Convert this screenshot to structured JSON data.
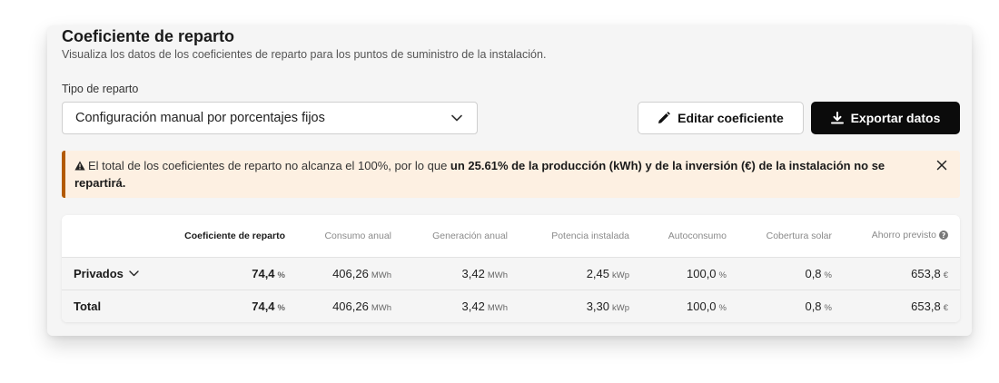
{
  "header": {
    "title": "Coeficiente de reparto",
    "subtitle": "Visualiza los datos de los coeficientes de reparto para los puntos de suministro de la instalación."
  },
  "distribution": {
    "label": "Tipo de reparto",
    "selected": "Configuración manual por porcentajes fijos"
  },
  "actions": {
    "edit_label": "Editar coeficiente",
    "export_label": "Exportar datos"
  },
  "alert": {
    "text_before": "El total de los coeficientes de reparto no alcanza el 100%, por lo que ",
    "text_bold": "un 25.61% de la producción (kWh) y de la inversión (€) de la instalación no se repartirá.",
    "color_border": "#b35a00",
    "color_bg": "#fdf0e2"
  },
  "table": {
    "columns": [
      "",
      "Coeficiente de reparto",
      "Consumo anual",
      "Generación anual",
      "Potencia instalada",
      "Autoconsumo",
      "Cobertura solar",
      "Ahorro previsto"
    ],
    "rows": [
      {
        "name": "Privados",
        "coef": "74,4",
        "coef_unit": "%",
        "consumo": "406,26",
        "consumo_unit": "MWh",
        "generacion": "3,42",
        "generacion_unit": "MWh",
        "potencia": "2,45",
        "potencia_unit": "kWp",
        "autoconsumo": "100,0",
        "autoconsumo_unit": "%",
        "cobertura": "0,8",
        "cobertura_unit": "%",
        "ahorro": "653,8",
        "ahorro_unit": "€"
      },
      {
        "name": "Total",
        "coef": "74,4",
        "coef_unit": "%",
        "consumo": "406,26",
        "consumo_unit": "MWh",
        "generacion": "3,42",
        "generacion_unit": "MWh",
        "potencia": "3,30",
        "potencia_unit": "kWp",
        "autoconsumo": "100,0",
        "autoconsumo_unit": "%",
        "cobertura": "0,8",
        "cobertura_unit": "%",
        "ahorro": "653,8",
        "ahorro_unit": "€"
      }
    ]
  },
  "icons": {
    "edit": "pencil-icon",
    "export": "download-icon",
    "warning": "warning-triangle-icon",
    "close": "close-icon",
    "select": "chevron-down-icon",
    "info": "info-circle-icon"
  }
}
